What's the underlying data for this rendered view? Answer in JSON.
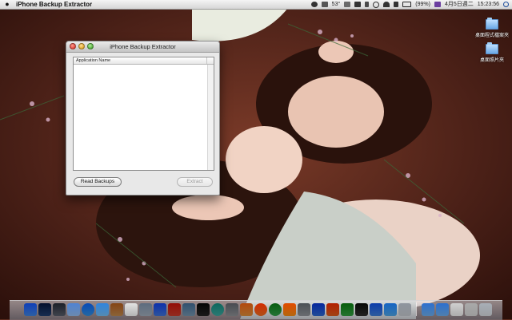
{
  "menubar": {
    "app_name": "iPhone Backup Extractor",
    "temperature": "53°",
    "battery": "(99%)",
    "date": "4月5日週二",
    "time": "15:23:56"
  },
  "desktop": {
    "icons": [
      {
        "label": "桌面程式檔案夾",
        "icon": "folder-icon"
      },
      {
        "label": "桌面照片夾",
        "icon": "folder-icon"
      }
    ]
  },
  "window": {
    "title": "iPhone Backup Extractor",
    "list_header": "Application Name",
    "read_button": "Read Backups",
    "extract_button": "Extract"
  },
  "dock": {
    "apps": [
      {
        "name": "finder-icon",
        "color": "#3d7fd9"
      },
      {
        "name": "dashboard-icon",
        "color": "#1f3d6b"
      },
      {
        "name": "mission-control-icon",
        "color": "#555a66"
      },
      {
        "name": "mail-icon",
        "color": "#8fb7e8"
      },
      {
        "name": "safari-icon",
        "color": "#2f8ad8"
      },
      {
        "name": "ichat-icon",
        "color": "#6fb8ee"
      },
      {
        "name": "address-book-icon",
        "color": "#b8844a"
      },
      {
        "name": "ical-icon",
        "color": "#f0f0f0"
      },
      {
        "name": "preview-icon",
        "color": "#9aa6b4"
      },
      {
        "name": "itunes-icon",
        "color": "#3c6fd1"
      },
      {
        "name": "photo-booth-icon",
        "color": "#c23a2a"
      },
      {
        "name": "iphoto-icon",
        "color": "#6f8fa8"
      },
      {
        "name": "iterm-icon",
        "color": "#222222"
      },
      {
        "name": "time-machine-icon",
        "color": "#3aa29a"
      },
      {
        "name": "system-preferences-icon",
        "color": "#888b90"
      },
      {
        "name": "image-capture-icon",
        "color": "#d6893a"
      },
      {
        "name": "firefox-icon",
        "color": "#e86a1f"
      },
      {
        "name": "chrome-icon",
        "color": "#2f9a48"
      },
      {
        "name": "vlc-icon",
        "color": "#f08a14"
      },
      {
        "name": "trash-can-icon",
        "color": "#8b8f95"
      },
      {
        "name": "word-icon",
        "color": "#2a64c9"
      },
      {
        "name": "powerpoint-icon",
        "color": "#d65a1c"
      },
      {
        "name": "excel-icon",
        "color": "#2f9a3f"
      },
      {
        "name": "terminal-icon",
        "color": "#2d2d2d"
      },
      {
        "name": "user-icon",
        "color": "#3b7bd1"
      },
      {
        "name": "apps-icon",
        "color": "#4ba0e0"
      },
      {
        "name": "phone-icon",
        "color": "#bfc3c9"
      },
      {
        "name": "applications-folder-icon",
        "color": "#6aa9e6"
      },
      {
        "name": "documents-folder-icon",
        "color": "#6aa9e6"
      },
      {
        "name": "downloads-stack-icon",
        "color": "#e6e6e6"
      },
      {
        "name": "screenshots-stack-icon",
        "color": "#d0d0d0"
      },
      {
        "name": "trash-icon",
        "color": "#cfd3d8"
      }
    ]
  }
}
